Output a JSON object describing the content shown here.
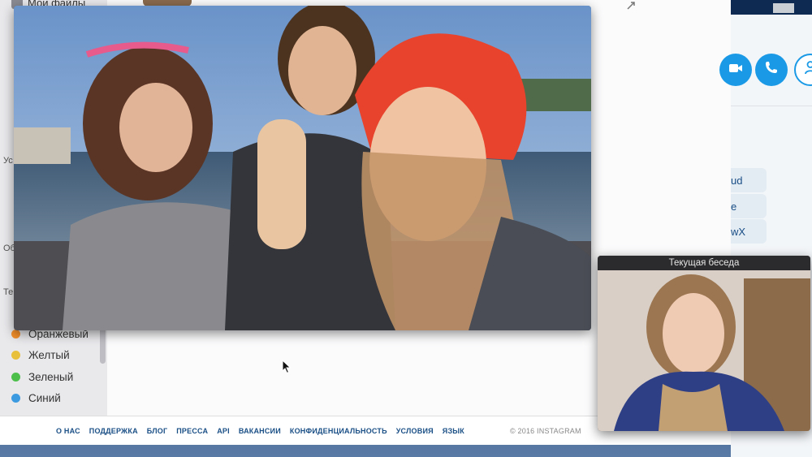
{
  "finder": {
    "sidebar_top": "Мои файлы",
    "side_letters": [
      "Ус",
      "Об",
      "Те"
    ],
    "tags": [
      {
        "label": "Оранжевый",
        "color": "#f4902c"
      },
      {
        "label": "Желтый",
        "color": "#e8c039"
      },
      {
        "label": "Зеленый",
        "color": "#4cbf4a"
      },
      {
        "label": "Синий",
        "color": "#3c9ae0"
      }
    ]
  },
  "instagram_footer": {
    "links": [
      "О НАС",
      "ПОДДЕРЖКА",
      "БЛОГ",
      "ПРЕССА",
      "API",
      "ВАКАНСИИ",
      "КОНФИДЕНЦИАЛЬНОСТЬ",
      "УСЛОВИЯ",
      "ЯЗЫК"
    ],
    "copyright": "© 2016 INSTAGRAM"
  },
  "skype": {
    "chat_snippets": [
      "ud",
      "e",
      "wX"
    ],
    "accent": "#1a9ae6"
  },
  "current_call": {
    "title": "Текущая беседа"
  }
}
